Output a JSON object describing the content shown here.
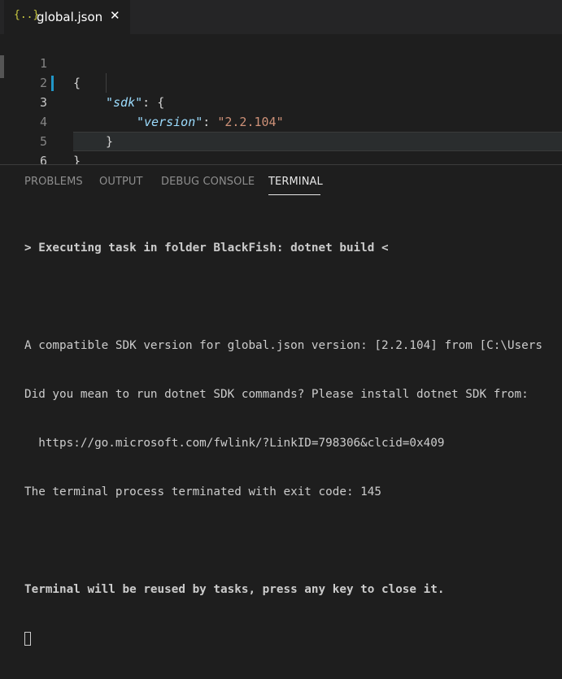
{
  "tab": {
    "icon": "{..}",
    "label": "global.json",
    "close": "✕"
  },
  "editor": {
    "lines": [
      {
        "num": "1",
        "text": "{"
      },
      {
        "num": "2",
        "key": "\"sdk\"",
        "after": ": {"
      },
      {
        "num": "3",
        "key": "\"version\"",
        "after": ": ",
        "value": "\"2.2.104\""
      },
      {
        "num": "4",
        "text": "}"
      },
      {
        "num": "5",
        "text": "}"
      },
      {
        "num": "6",
        "text": ""
      }
    ]
  },
  "panel": {
    "tabs": [
      "PROBLEMS",
      "OUTPUT",
      "DEBUG CONSOLE",
      "TERMINAL"
    ],
    "active_tab": "TERMINAL",
    "terminal": {
      "line1": "> Executing task in folder BlackFish: dotnet build <",
      "line2": "",
      "line3": "A compatible SDK version for global.json version: [2.2.104] from [C:\\Users",
      "line4": "Did you mean to run dotnet SDK commands? Please install dotnet SDK from:",
      "line5": "  https://go.microsoft.com/fwlink/?LinkID=798306&clcid=0x409",
      "line6": "The terminal process terminated with exit code: 145",
      "line7": "",
      "line8": "Terminal will be reused by tasks, press any key to close it."
    }
  },
  "colors": {
    "key": "#9cdcfe",
    "string": "#ce9178",
    "json_icon": "#cbcb41",
    "modified_bar": "#2196c7"
  }
}
